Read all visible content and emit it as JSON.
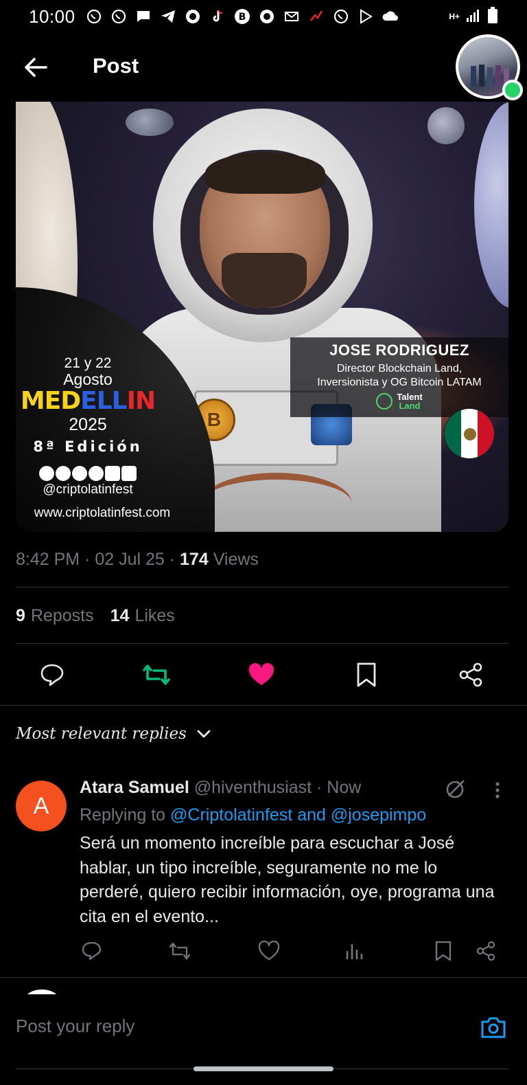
{
  "status_bar": {
    "time": "10:00",
    "network": "H+",
    "app_icons": [
      "whatsapp-icon",
      "whatsapp-icon",
      "message-icon",
      "telegram-icon",
      "browser-icon",
      "tiktok-icon",
      "bitcoin-icon",
      "browser-icon",
      "gmail-icon",
      "fitness-icon",
      "whatsapp-icon",
      "play-icon",
      "cloud-icon"
    ]
  },
  "header": {
    "title": "Post"
  },
  "poster": {
    "dates": "21 y 22",
    "month": "Agosto",
    "city_parts": [
      "MED",
      "ELL",
      "IN"
    ],
    "year": "2025",
    "edition": "8ª Edición",
    "handle": "@criptolatinfest",
    "website": "www.criptolatinfest.com",
    "speaker_name": "JOSE RODRIGUEZ",
    "speaker_role_line1": "Director Blockchain Land,",
    "speaker_role_line2": "Inversionista y OG Bitcoin LATAM",
    "sponsor_top": "Talent",
    "sponsor_bottom": "Land",
    "coin_letter": "B",
    "flag_colors": [
      "#006847",
      "#ffffff",
      "#ce1126"
    ]
  },
  "post_meta": {
    "time": "8:42 PM",
    "date": "02 Jul 25",
    "views_count": "174",
    "views_label": "Views"
  },
  "stats": {
    "reposts_count": "9",
    "reposts_label": "Reposts",
    "likes_count": "14",
    "likes_label": "Likes"
  },
  "colors": {
    "repost_active": "#00ba7c",
    "like_active": "#f91880",
    "link": "#1d9bf0",
    "muted": "#71767b"
  },
  "replies_sort": {
    "label": "Most relevant replies"
  },
  "reply": {
    "avatar_letter": "A",
    "name": "Atara Samuel",
    "handle": "@hiventhusiast",
    "time": "Now",
    "replying_prefix": "Replying to",
    "replying_to": "@Criptolatinfest and @josepimpo",
    "text": "Será un momento increíble para escuchar a José hablar, un tipo increíble, seguramente no me lo perderé, quiero recibir información, oye, programa una cita en el evento..."
  },
  "composer": {
    "placeholder": "Post your reply"
  }
}
